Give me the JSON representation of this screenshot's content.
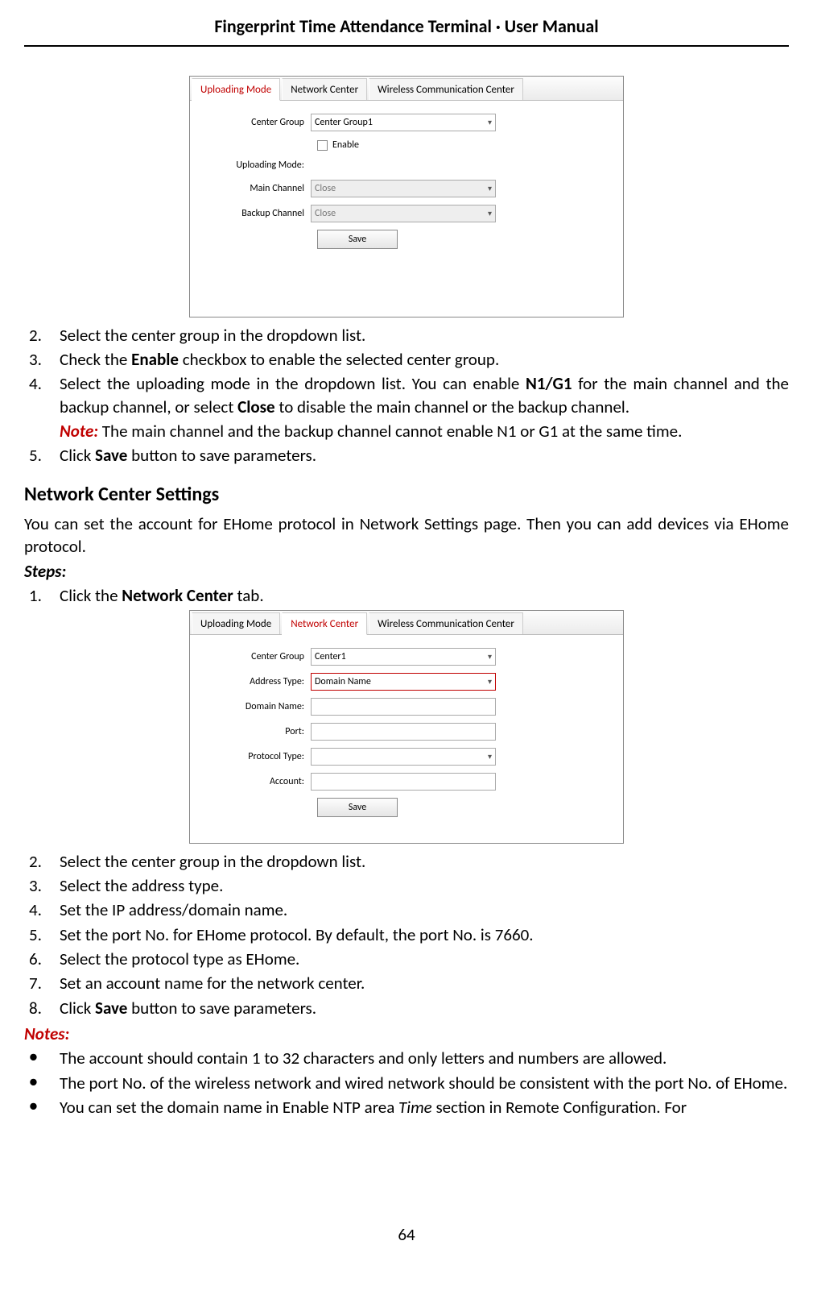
{
  "header": {
    "title": "Fingerprint Time Attendance Terminal · User Manual"
  },
  "figure1": {
    "tabs": [
      "Uploading Mode",
      "Network Center",
      "Wireless Communication Center"
    ],
    "active_tab": 0,
    "center_group_label": "Center Group",
    "center_group_value": "Center Group1",
    "enable_label": "Enable",
    "uploading_mode_label": "Uploading Mode:",
    "main_channel_label": "Main Channel",
    "main_channel_value": "Close",
    "backup_channel_label": "Backup Channel",
    "backup_channel_value": "Close",
    "save_label": "Save"
  },
  "steps_a": {
    "s2": "Select the center group in the dropdown list.",
    "s3_pre": "Check the ",
    "s3_bold": "Enable",
    "s3_post": " checkbox to enable the selected center group.",
    "s4_pre": "Select the uploading mode in the dropdown list. You can enable ",
    "s4_b1": "N1/G1",
    "s4_mid": " for the main channel and the backup channel, or select ",
    "s4_b2": "Close",
    "s4_post": " to disable the main channel or the backup channel.",
    "s4_note_label": "Note:",
    "s4_note_text": " The main channel and the backup channel cannot enable N1 or G1 at the same time.",
    "s5_pre": "Click ",
    "s5_bold": "Save",
    "s5_post": " button to save parameters."
  },
  "section2": {
    "heading": "Network Center Settings",
    "intro": "You can set the account for EHome protocol in Network Settings page. Then you can add devices via EHome protocol.",
    "steps_label": "Steps:",
    "step1_pre": "Click the ",
    "step1_bold": "Network Center",
    "step1_post": " tab."
  },
  "figure2": {
    "tabs": [
      "Uploading Mode",
      "Network Center",
      "Wireless Communication Center"
    ],
    "active_tab": 1,
    "center_group_label": "Center Group",
    "center_group_value": "Center1",
    "address_type_label": "Address Type:",
    "address_type_value": "Domain Name",
    "domain_name_label": "Domain Name:",
    "port_label": "Port:",
    "protocol_type_label": "Protocol Type:",
    "account_label": "Account:",
    "save_label": "Save"
  },
  "steps_b": {
    "s2": "Select the center group in the dropdown list.",
    "s3": "Select the address type.",
    "s4": "Set the IP address/domain name.",
    "s5": "Set the port No. for EHome protocol. By default, the port No. is 7660.",
    "s6": "Select the protocol type as EHome.",
    "s7": "Set an account name for the network center.",
    "s8_pre": "Click ",
    "s8_bold": "Save",
    "s8_post": " button to save parameters."
  },
  "notes": {
    "label": "Notes:",
    "b1": "The account should contain 1 to 32 characters and only letters and numbers are allowed.",
    "b2": "The port No. of the wireless network and wired network should be consistent with the port No. of EHome.",
    "b3_pre": "You can set the domain name in Enable NTP area ",
    "b3_it": "Time",
    "b3_post": " section in Remote Configuration. For"
  },
  "page_number": "64",
  "nums": {
    "n1": "1.",
    "n2": "2.",
    "n3": "3.",
    "n4": "4.",
    "n5": "5.",
    "n6": "6.",
    "n7": "7.",
    "n8": "8."
  },
  "bullet": "●"
}
